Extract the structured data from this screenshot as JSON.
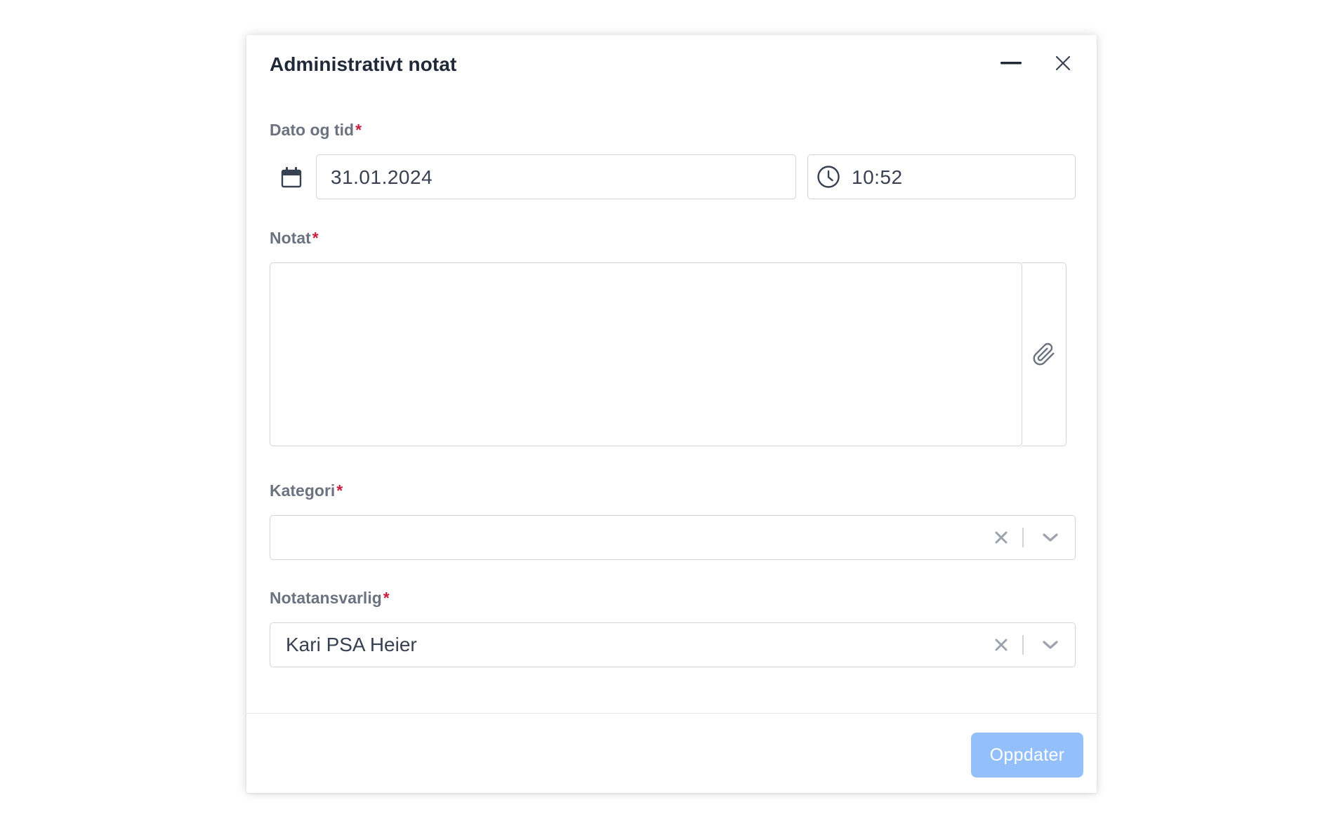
{
  "dialog": {
    "title": "Administrativt notat",
    "minimize_icon": "minus-icon",
    "close_icon": "close-icon"
  },
  "datetime": {
    "label": "Dato og tid",
    "required_mark": "*",
    "calendar_icon": "calendar-icon",
    "date_value": "31.01.2024",
    "clock_icon": "clock-icon",
    "time_value": "10:52"
  },
  "note": {
    "label": "Notat",
    "required_mark": "*",
    "value": "",
    "attach_icon": "paperclip-icon"
  },
  "category": {
    "label": "Kategori",
    "required_mark": "*",
    "value": "",
    "clear_icon": "clear-x-icon",
    "dropdown_icon": "chevron-down-icon"
  },
  "responsible": {
    "label": "Notatansvarlig",
    "required_mark": "*",
    "value": "Kari PSA Heier",
    "clear_icon": "clear-x-icon",
    "dropdown_icon": "chevron-down-icon"
  },
  "footer": {
    "update_label": "Oppdater",
    "update_color": "#93c0fb"
  },
  "colors": {
    "required": "#c81e3c",
    "label": "#6b7280",
    "border": "#d1d5db"
  }
}
